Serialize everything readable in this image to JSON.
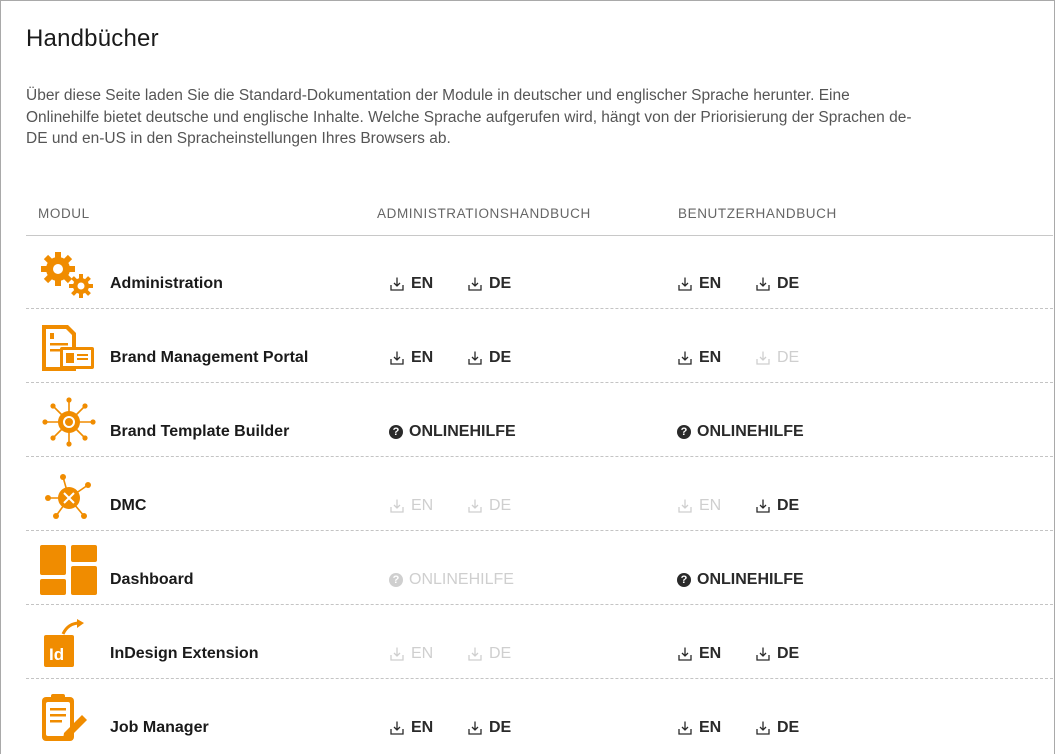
{
  "page": {
    "title": "Handbücher",
    "intro": "Über diese Seite laden Sie die Standard-Dokumentation der Module in deutscher und englischer Sprache herunter. Eine Onlinehilfe bietet deutsche und englische Inhalte. Welche Sprache aufgerufen wird, hängt von der Priorisierung der Sprachen de-DE und en-US in den Spracheinstellungen Ihres Browsers ab."
  },
  "columns": {
    "module": "MODUL",
    "admin": "ADMINISTRATIONSHANDBUCH",
    "user": "BENUTZERHANDBUCH"
  },
  "accent_color": "#f08c00",
  "rows": [
    {
      "name": "Administration",
      "icon": "gears-icon",
      "admin": {
        "type": "download",
        "en": "EN",
        "de": "DE",
        "en_enabled": true,
        "de_enabled": true
      },
      "user": {
        "type": "download",
        "en": "EN",
        "de": "DE",
        "en_enabled": true,
        "de_enabled": true
      }
    },
    {
      "name": "Brand Management Portal",
      "icon": "document-card-icon",
      "admin": {
        "type": "download",
        "en": "EN",
        "de": "DE",
        "en_enabled": true,
        "de_enabled": true
      },
      "user": {
        "type": "download",
        "en": "EN",
        "de": "DE",
        "en_enabled": true,
        "de_enabled": false
      }
    },
    {
      "name": "Brand Template Builder",
      "icon": "network-hub-icon",
      "admin": {
        "type": "help",
        "label": "ONLINEHILFE",
        "enabled": true
      },
      "user": {
        "type": "help",
        "label": "ONLINEHILFE",
        "enabled": true
      }
    },
    {
      "name": "DMC",
      "icon": "molecule-icon",
      "admin": {
        "type": "download",
        "en": "EN",
        "de": "DE",
        "en_enabled": false,
        "de_enabled": false
      },
      "user": {
        "type": "download",
        "en": "EN",
        "de": "DE",
        "en_enabled": false,
        "de_enabled": true
      }
    },
    {
      "name": "Dashboard",
      "icon": "dashboard-tiles-icon",
      "admin": {
        "type": "help",
        "label": "ONLINEHILFE",
        "enabled": false
      },
      "user": {
        "type": "help",
        "label": "ONLINEHILFE",
        "enabled": true
      }
    },
    {
      "name": "InDesign Extension",
      "icon": "indesign-icon",
      "admin": {
        "type": "download",
        "en": "EN",
        "de": "DE",
        "en_enabled": false,
        "de_enabled": false
      },
      "user": {
        "type": "download",
        "en": "EN",
        "de": "DE",
        "en_enabled": true,
        "de_enabled": true
      }
    },
    {
      "name": "Job Manager",
      "icon": "clipboard-pen-icon",
      "admin": {
        "type": "download",
        "en": "EN",
        "de": "DE",
        "en_enabled": true,
        "de_enabled": true
      },
      "user": {
        "type": "download",
        "en": "EN",
        "de": "DE",
        "en_enabled": true,
        "de_enabled": true
      }
    }
  ]
}
